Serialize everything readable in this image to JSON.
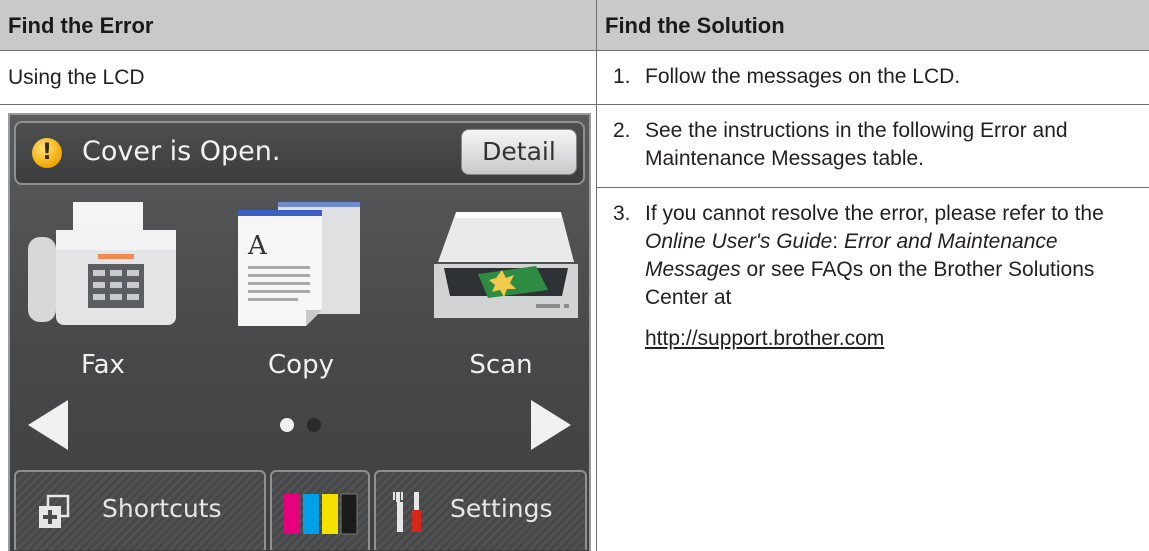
{
  "table": {
    "col1_header": "Find the Error",
    "col2_header": "Find the Solution",
    "row1_text": "Using the LCD"
  },
  "lcd": {
    "status_message": "Cover is Open.",
    "detail_button": "Detail",
    "warning_symbol": "!",
    "apps": [
      {
        "label": "Fax",
        "icon": "fax-icon"
      },
      {
        "label": "Copy",
        "icon": "copy-icon"
      },
      {
        "label": "Scan",
        "icon": "scan-icon"
      }
    ],
    "page_indicator": {
      "current": 1,
      "total": 2
    },
    "bottom": {
      "shortcuts_label": "Shortcuts",
      "settings_label": "Settings",
      "ink_colors": [
        "#e6007e",
        "#00a0e9",
        "#f5e100",
        "#1a1a1a"
      ]
    }
  },
  "solution": {
    "steps": [
      {
        "num": "1.",
        "text": "Follow the messages on the LCD."
      },
      {
        "num": "2.",
        "text": "See the instructions in the following Error and Maintenance Messages table."
      },
      {
        "num": "3.",
        "pre": "If you cannot resolve the error, please refer to the ",
        "em1": "Online User's Guide",
        "mid": ": ",
        "em2": "Error and Maintenance Messages",
        "post": " or see FAQs on the Brother Solutions Center at"
      }
    ],
    "link": "http://support.brother.com"
  }
}
